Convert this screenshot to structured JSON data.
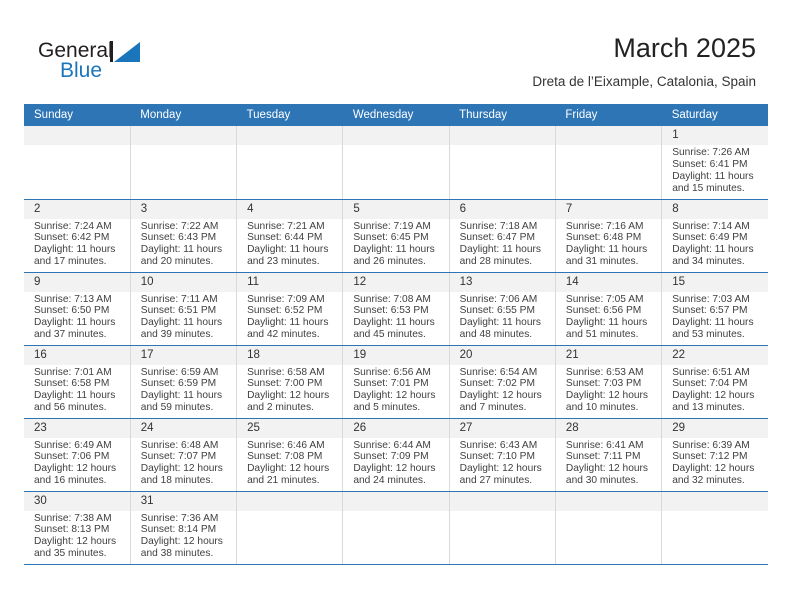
{
  "brand": {
    "name_part1": "General",
    "name_part2": "Blue",
    "logo_icon": "triangle-logo-icon"
  },
  "header": {
    "title": "March 2025",
    "subtitle": "Dreta de l’Eixample, Catalonia, Spain"
  },
  "colors": {
    "header_blue": "#2e75b6",
    "brand_blue": "#1b75bb",
    "daynum_bg": "#f2f2f2",
    "cell_border": "#d9d9d9"
  },
  "weekdays": [
    "Sunday",
    "Monday",
    "Tuesday",
    "Wednesday",
    "Thursday",
    "Friday",
    "Saturday"
  ],
  "weeks": [
    [
      {
        "day": "",
        "blank": true
      },
      {
        "day": "",
        "blank": true
      },
      {
        "day": "",
        "blank": true
      },
      {
        "day": "",
        "blank": true
      },
      {
        "day": "",
        "blank": true
      },
      {
        "day": "",
        "blank": true
      },
      {
        "day": "1",
        "sunrise": "Sunrise: 7:26 AM",
        "sunset": "Sunset: 6:41 PM",
        "daylight1": "Daylight: 11 hours",
        "daylight2": "and 15 minutes."
      }
    ],
    [
      {
        "day": "2",
        "sunrise": "Sunrise: 7:24 AM",
        "sunset": "Sunset: 6:42 PM",
        "daylight1": "Daylight: 11 hours",
        "daylight2": "and 17 minutes."
      },
      {
        "day": "3",
        "sunrise": "Sunrise: 7:22 AM",
        "sunset": "Sunset: 6:43 PM",
        "daylight1": "Daylight: 11 hours",
        "daylight2": "and 20 minutes."
      },
      {
        "day": "4",
        "sunrise": "Sunrise: 7:21 AM",
        "sunset": "Sunset: 6:44 PM",
        "daylight1": "Daylight: 11 hours",
        "daylight2": "and 23 minutes."
      },
      {
        "day": "5",
        "sunrise": "Sunrise: 7:19 AM",
        "sunset": "Sunset: 6:45 PM",
        "daylight1": "Daylight: 11 hours",
        "daylight2": "and 26 minutes."
      },
      {
        "day": "6",
        "sunrise": "Sunrise: 7:18 AM",
        "sunset": "Sunset: 6:47 PM",
        "daylight1": "Daylight: 11 hours",
        "daylight2": "and 28 minutes."
      },
      {
        "day": "7",
        "sunrise": "Sunrise: 7:16 AM",
        "sunset": "Sunset: 6:48 PM",
        "daylight1": "Daylight: 11 hours",
        "daylight2": "and 31 minutes."
      },
      {
        "day": "8",
        "sunrise": "Sunrise: 7:14 AM",
        "sunset": "Sunset: 6:49 PM",
        "daylight1": "Daylight: 11 hours",
        "daylight2": "and 34 minutes."
      }
    ],
    [
      {
        "day": "9",
        "sunrise": "Sunrise: 7:13 AM",
        "sunset": "Sunset: 6:50 PM",
        "daylight1": "Daylight: 11 hours",
        "daylight2": "and 37 minutes."
      },
      {
        "day": "10",
        "sunrise": "Sunrise: 7:11 AM",
        "sunset": "Sunset: 6:51 PM",
        "daylight1": "Daylight: 11 hours",
        "daylight2": "and 39 minutes."
      },
      {
        "day": "11",
        "sunrise": "Sunrise: 7:09 AM",
        "sunset": "Sunset: 6:52 PM",
        "daylight1": "Daylight: 11 hours",
        "daylight2": "and 42 minutes."
      },
      {
        "day": "12",
        "sunrise": "Sunrise: 7:08 AM",
        "sunset": "Sunset: 6:53 PM",
        "daylight1": "Daylight: 11 hours",
        "daylight2": "and 45 minutes."
      },
      {
        "day": "13",
        "sunrise": "Sunrise: 7:06 AM",
        "sunset": "Sunset: 6:55 PM",
        "daylight1": "Daylight: 11 hours",
        "daylight2": "and 48 minutes."
      },
      {
        "day": "14",
        "sunrise": "Sunrise: 7:05 AM",
        "sunset": "Sunset: 6:56 PM",
        "daylight1": "Daylight: 11 hours",
        "daylight2": "and 51 minutes."
      },
      {
        "day": "15",
        "sunrise": "Sunrise: 7:03 AM",
        "sunset": "Sunset: 6:57 PM",
        "daylight1": "Daylight: 11 hours",
        "daylight2": "and 53 minutes."
      }
    ],
    [
      {
        "day": "16",
        "sunrise": "Sunrise: 7:01 AM",
        "sunset": "Sunset: 6:58 PM",
        "daylight1": "Daylight: 11 hours",
        "daylight2": "and 56 minutes."
      },
      {
        "day": "17",
        "sunrise": "Sunrise: 6:59 AM",
        "sunset": "Sunset: 6:59 PM",
        "daylight1": "Daylight: 11 hours",
        "daylight2": "and 59 minutes."
      },
      {
        "day": "18",
        "sunrise": "Sunrise: 6:58 AM",
        "sunset": "Sunset: 7:00 PM",
        "daylight1": "Daylight: 12 hours",
        "daylight2": "and 2 minutes."
      },
      {
        "day": "19",
        "sunrise": "Sunrise: 6:56 AM",
        "sunset": "Sunset: 7:01 PM",
        "daylight1": "Daylight: 12 hours",
        "daylight2": "and 5 minutes."
      },
      {
        "day": "20",
        "sunrise": "Sunrise: 6:54 AM",
        "sunset": "Sunset: 7:02 PM",
        "daylight1": "Daylight: 12 hours",
        "daylight2": "and 7 minutes."
      },
      {
        "day": "21",
        "sunrise": "Sunrise: 6:53 AM",
        "sunset": "Sunset: 7:03 PM",
        "daylight1": "Daylight: 12 hours",
        "daylight2": "and 10 minutes."
      },
      {
        "day": "22",
        "sunrise": "Sunrise: 6:51 AM",
        "sunset": "Sunset: 7:04 PM",
        "daylight1": "Daylight: 12 hours",
        "daylight2": "and 13 minutes."
      }
    ],
    [
      {
        "day": "23",
        "sunrise": "Sunrise: 6:49 AM",
        "sunset": "Sunset: 7:06 PM",
        "daylight1": "Daylight: 12 hours",
        "daylight2": "and 16 minutes."
      },
      {
        "day": "24",
        "sunrise": "Sunrise: 6:48 AM",
        "sunset": "Sunset: 7:07 PM",
        "daylight1": "Daylight: 12 hours",
        "daylight2": "and 18 minutes."
      },
      {
        "day": "25",
        "sunrise": "Sunrise: 6:46 AM",
        "sunset": "Sunset: 7:08 PM",
        "daylight1": "Daylight: 12 hours",
        "daylight2": "and 21 minutes."
      },
      {
        "day": "26",
        "sunrise": "Sunrise: 6:44 AM",
        "sunset": "Sunset: 7:09 PM",
        "daylight1": "Daylight: 12 hours",
        "daylight2": "and 24 minutes."
      },
      {
        "day": "27",
        "sunrise": "Sunrise: 6:43 AM",
        "sunset": "Sunset: 7:10 PM",
        "daylight1": "Daylight: 12 hours",
        "daylight2": "and 27 minutes."
      },
      {
        "day": "28",
        "sunrise": "Sunrise: 6:41 AM",
        "sunset": "Sunset: 7:11 PM",
        "daylight1": "Daylight: 12 hours",
        "daylight2": "and 30 minutes."
      },
      {
        "day": "29",
        "sunrise": "Sunrise: 6:39 AM",
        "sunset": "Sunset: 7:12 PM",
        "daylight1": "Daylight: 12 hours",
        "daylight2": "and 32 minutes."
      }
    ],
    [
      {
        "day": "30",
        "sunrise": "Sunrise: 7:38 AM",
        "sunset": "Sunset: 8:13 PM",
        "daylight1": "Daylight: 12 hours",
        "daylight2": "and 35 minutes."
      },
      {
        "day": "31",
        "sunrise": "Sunrise: 7:36 AM",
        "sunset": "Sunset: 8:14 PM",
        "daylight1": "Daylight: 12 hours",
        "daylight2": "and 38 minutes."
      },
      {
        "day": "",
        "blank": true
      },
      {
        "day": "",
        "blank": true
      },
      {
        "day": "",
        "blank": true
      },
      {
        "day": "",
        "blank": true
      },
      {
        "day": "",
        "blank": true
      }
    ]
  ]
}
